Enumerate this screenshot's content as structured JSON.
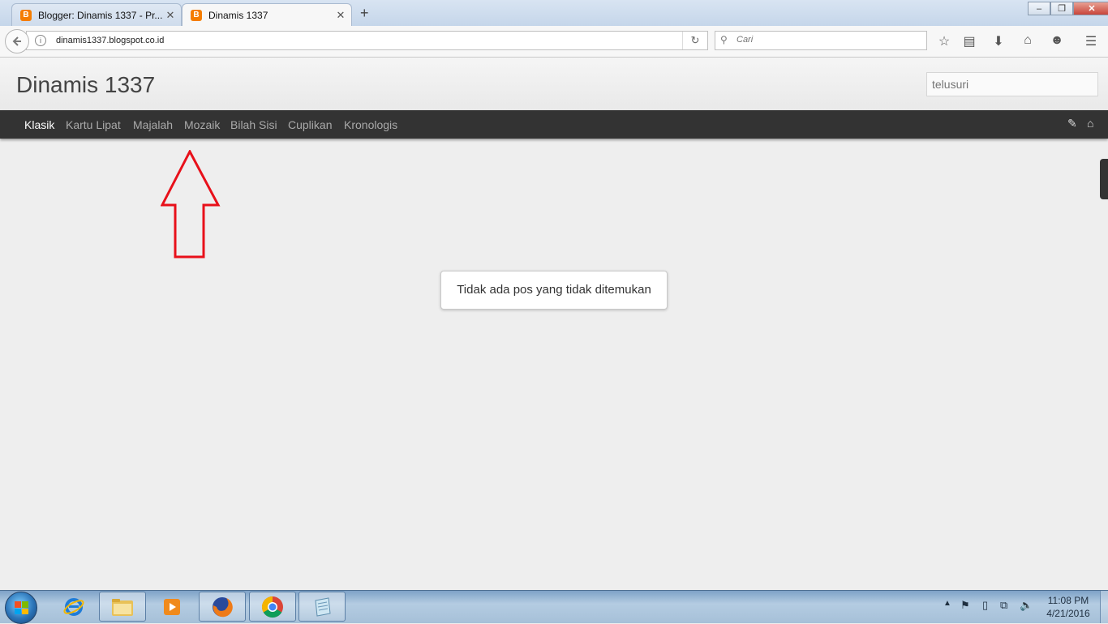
{
  "browser": {
    "tabs": [
      {
        "title": "Blogger: Dinamis 1337 - Pr...",
        "favicon": "blogger-icon",
        "active": false
      },
      {
        "title": "Dinamis 1337",
        "favicon": "blogger-icon",
        "active": true
      }
    ],
    "url": "dinamis1337.blogspot.co.id",
    "search_placeholder": "Cari",
    "toolbar_icons": [
      "star-icon",
      "reading-list-icon",
      "download-icon",
      "home-icon",
      "chat-icon",
      "menu-icon"
    ]
  },
  "blog": {
    "title": "Dinamis 1337",
    "search_placeholder": "telusuri",
    "views": [
      "Klasik",
      "Kartu Lipat",
      "Majalah",
      "Mozaik",
      "Bilah Sisi",
      "Cuplikan",
      "Kronologis"
    ],
    "active_view": "Klasik",
    "message": "Tidak ada pos yang tidak ditemukan"
  },
  "annotation": {
    "color": "#e8101a",
    "shape": "up-arrow"
  },
  "taskbar": {
    "apps": [
      "internet-explorer-icon",
      "file-explorer-icon",
      "media-player-icon",
      "firefox-icon",
      "chrome-icon",
      "notepad-icon"
    ],
    "clock_time": "11:08 PM",
    "clock_date": "4/21/2016"
  }
}
